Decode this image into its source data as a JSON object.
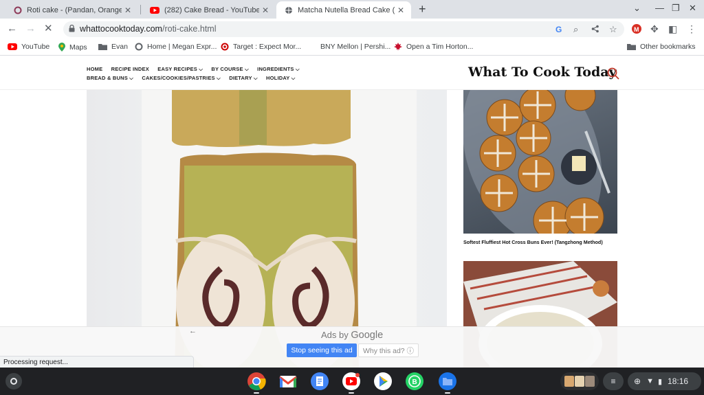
{
  "tabs": [
    {
      "title": "Roti cake - (Pandan, Orange, Cho",
      "favicon": "whattocooktoday-icon",
      "active": false
    },
    {
      "title": "(282) Cake Bread - YouTube",
      "favicon": "youtube-icon",
      "active": false
    },
    {
      "title": "Matcha Nutella Bread Cake (Roti",
      "favicon": "loading-globe-icon",
      "active": true
    }
  ],
  "new_tab_label": "+",
  "address_bar": {
    "domain": "whattocooktoday.com",
    "path": "/roti-cake.html"
  },
  "bookmarks": [
    {
      "label": "YouTube",
      "icon": "youtube-icon"
    },
    {
      "label": "Maps",
      "icon": "maps-pin-icon"
    },
    {
      "label": "Evan",
      "icon": "folder-icon"
    },
    {
      "label": "Home | Megan Expr...",
      "icon": "globe-ring-icon"
    },
    {
      "label": "Target : Expect Mor...",
      "icon": "target-icon"
    },
    {
      "label": "BNY Mellon | Pershi...",
      "icon": ""
    },
    {
      "label": "Open a Tim Horton...",
      "icon": "maple-leaf-icon"
    },
    {
      "label": "Other bookmarks",
      "icon": "folder-icon"
    }
  ],
  "site": {
    "logo": "What To Cook Today",
    "menu_row1": [
      "HOME",
      "RECIPE INDEX",
      "EASY RECIPES ⌵",
      "BY COURSE ⌵",
      "INGREDIENTS ⌵"
    ],
    "menu_row2": [
      "BREAD & BUNS ⌵",
      "CAKES/COOKIES/PASTRIES ⌵",
      "DIETARY ⌵",
      "HOLIDAY ⌵"
    ],
    "sidebar_caption": "Softest Fluffiest Hot Cross Buns Ever! (Tangzhong Method)"
  },
  "ad": {
    "ads_by": "Ads by",
    "google": "Google",
    "stop": "Stop seeing this ad",
    "why": "Why this ad? ⓘ"
  },
  "status_text": "Processing request...",
  "shelf": {
    "time": "18:16"
  },
  "colors": {
    "tab_strip": "#dee1e6",
    "accent_blue": "#4285f4",
    "shelf": "#202124",
    "logo_search": "#c0392b"
  }
}
